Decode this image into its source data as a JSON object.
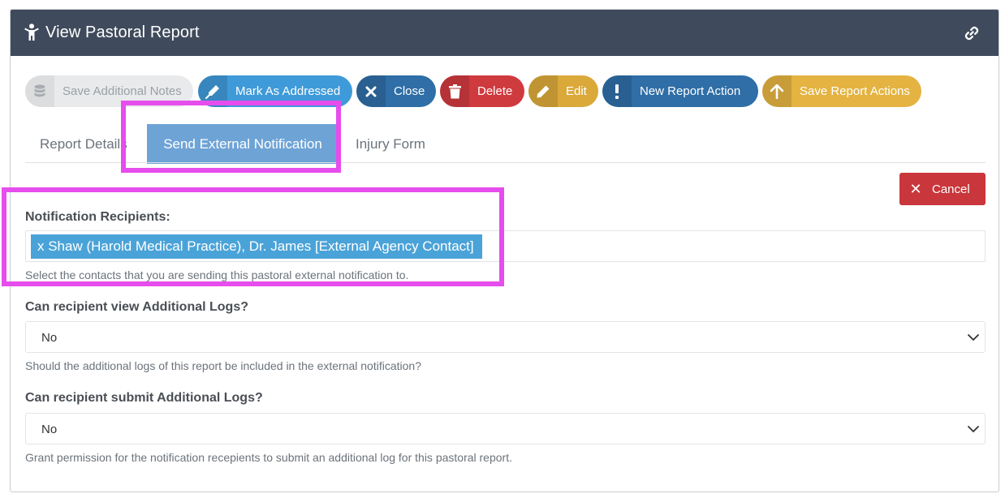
{
  "header": {
    "title": "View Pastoral Report",
    "person_icon": "person-icon",
    "link_icon": "link-icon",
    "bg_color": "#3f4b5c"
  },
  "toolbar": {
    "save_notes": {
      "label": "Save Additional Notes",
      "icon": "database-icon"
    },
    "mark_addressed": {
      "label": "Mark As Addressed",
      "icon": "pen-icon",
      "color": "#3f9ad9"
    },
    "close": {
      "label": "Close",
      "icon": "close-icon",
      "color": "#2f6ea6"
    },
    "delete": {
      "label": "Delete",
      "icon": "trash-icon",
      "color": "#cf3a3f"
    },
    "edit": {
      "label": "Edit",
      "icon": "pencil-icon",
      "color": "#dba93a"
    },
    "new_action": {
      "label": "New Report Action",
      "icon": "exclamation-icon",
      "color": "#2f6ea6"
    },
    "save_actions": {
      "label": "Save Report Actions",
      "icon": "arrow-up-icon",
      "color": "#e4b341"
    }
  },
  "tabs": [
    {
      "label": "Report Details",
      "active": false
    },
    {
      "label": "Send External Notification",
      "active": true
    },
    {
      "label": "Injury Form",
      "active": false
    }
  ],
  "cancel_label": "Cancel",
  "form": {
    "recipients": {
      "label": "Notification Recipients:",
      "tags": [
        "x Shaw (Harold Medical Practice), Dr. James [External Agency Contact]"
      ],
      "help": "Select the contacts that you are sending this pastoral external notification to."
    },
    "view_logs": {
      "label": "Can recipient view Additional Logs?",
      "value": "No",
      "help": "Should the additional logs of this report be included in the external notification?"
    },
    "submit_logs": {
      "label": "Can recipient submit Additional Logs?",
      "value": "No",
      "help": "Grant permission for the notification recepients to submit an additional log for this pastoral report."
    }
  },
  "highlight_color": "#e64ded"
}
